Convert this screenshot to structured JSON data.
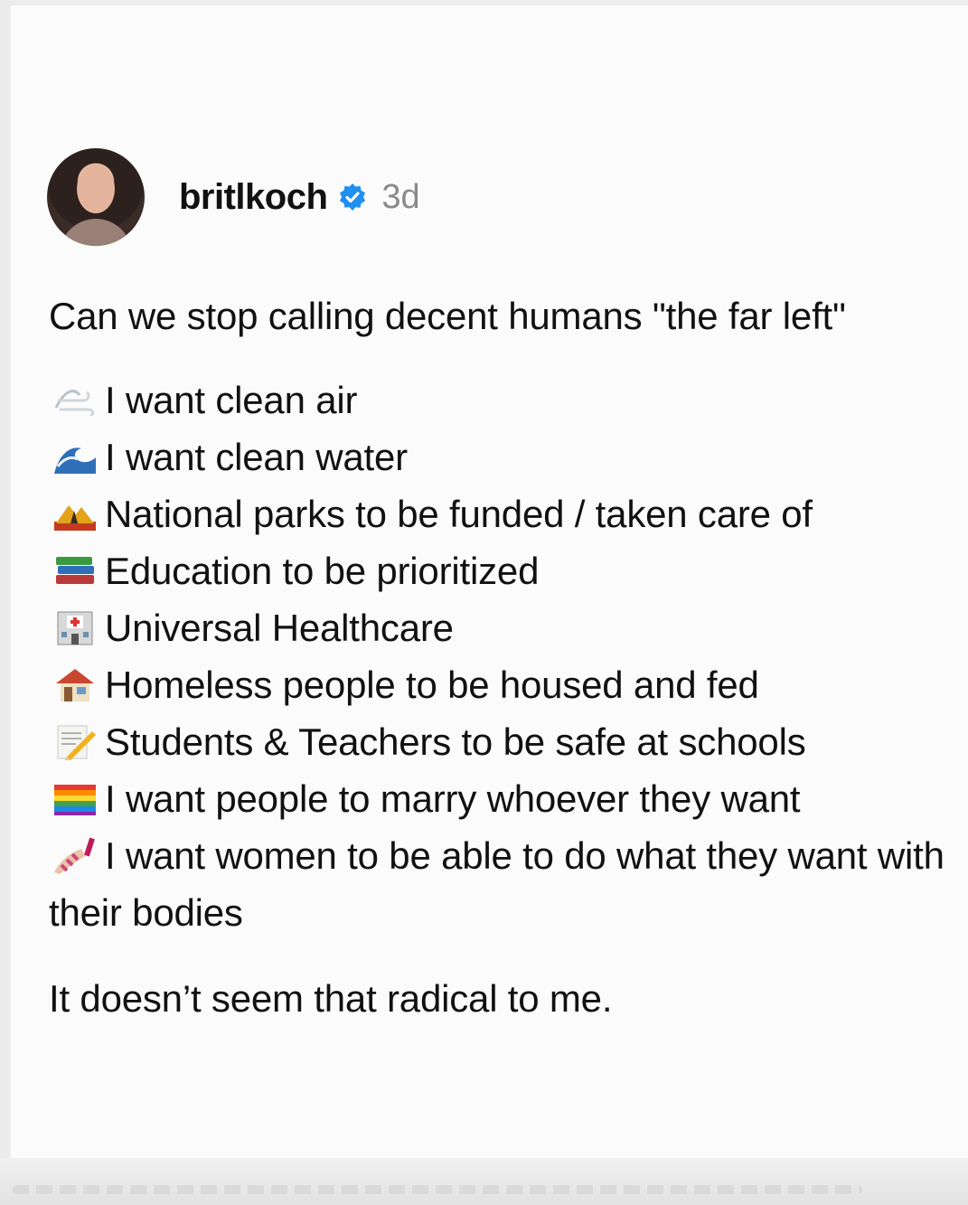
{
  "post": {
    "username": "britlkoch",
    "time": "3d",
    "verified_color": "#1f8ff0",
    "intro": "Can we stop calling decent humans \"the far left\"",
    "items": [
      {
        "icon": "wind-icon",
        "text": "I want clean air"
      },
      {
        "icon": "wave-icon",
        "text": "I want clean water"
      },
      {
        "icon": "national-park-icon",
        "text": "National parks to be funded / taken care of"
      },
      {
        "icon": "books-icon",
        "text": "Education to be prioritized"
      },
      {
        "icon": "hospital-icon",
        "text": "Universal Healthcare"
      },
      {
        "icon": "house-icon",
        "text": "Homeless people to be housed and fed"
      },
      {
        "icon": "memo-icon",
        "text": "Students & Teachers to be safe at schools"
      },
      {
        "icon": "rainbow-flag-icon",
        "text": "I want people to marry whoever they want"
      },
      {
        "icon": "nail-polish-icon",
        "text": "I want women to be able to do what they want with their bodies"
      }
    ],
    "outro": "It doesn’t seem that radical to me."
  }
}
